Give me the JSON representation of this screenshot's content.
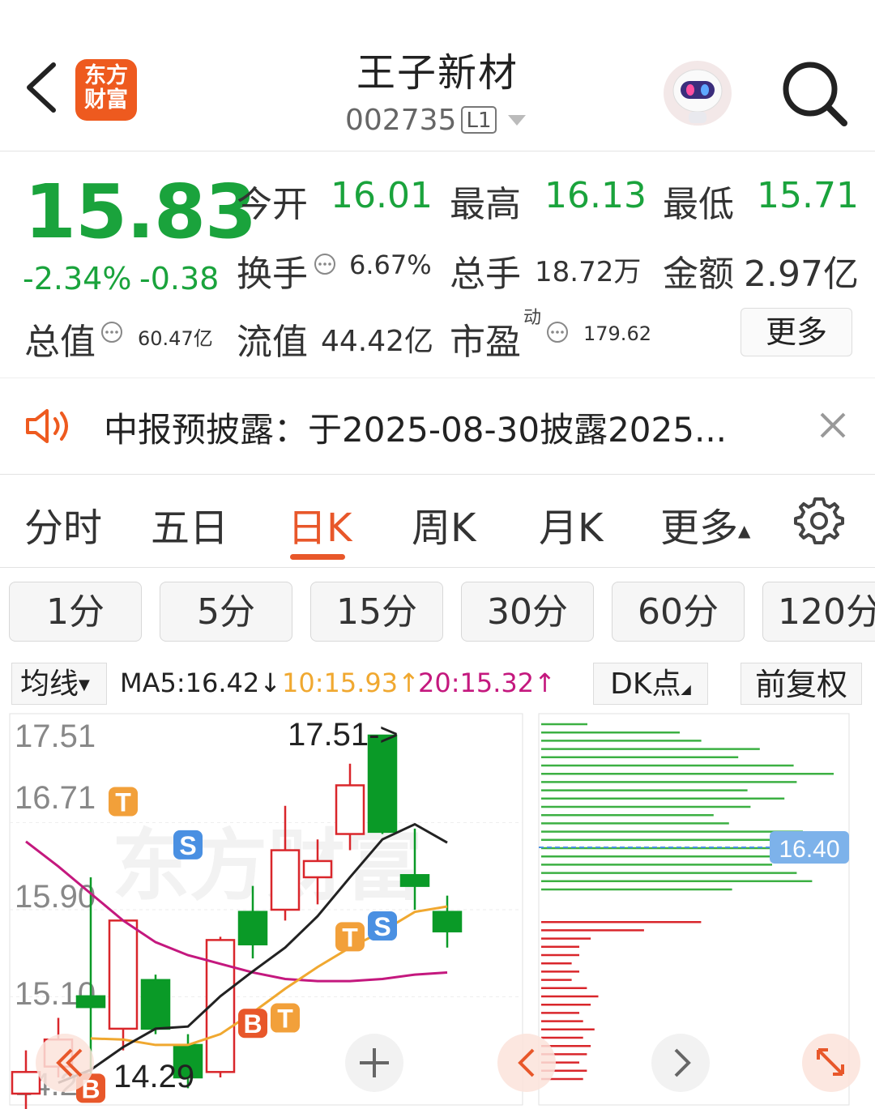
{
  "header": {
    "stock_name": "王子新材",
    "stock_code": "002735",
    "level_badge": "L1",
    "brand_logo_text": "东方财富"
  },
  "quote": {
    "price": "15.83",
    "change_pct": "-2.34%",
    "change_abs": "-0.38",
    "open_label": "今开",
    "open_value": "16.01",
    "high_label": "最高",
    "high_value": "16.13",
    "low_label": "最低",
    "low_value": "15.71",
    "turnover_label": "换手",
    "turnover_value": "6.67%",
    "volume_label": "总手",
    "volume_value": "18.72万",
    "amount_label": "金额",
    "amount_value": "2.97亿",
    "mktcap_label": "总值",
    "mktcap_value": "60.47亿",
    "float_label": "流值",
    "float_value": "44.42亿",
    "pe_label": "市盈",
    "pe_sup": "动",
    "pe_value": "179.62",
    "more_label": "更多"
  },
  "notice": {
    "text": "中报预披露：于2025-08-30披露2025..."
  },
  "tabs": {
    "items": [
      "分时",
      "五日",
      "日K",
      "周K",
      "月K",
      "更多"
    ],
    "active": "日K"
  },
  "minute_buttons": [
    "1分",
    "5分",
    "15分",
    "30分",
    "60分",
    "120分"
  ],
  "ma_row": {
    "ma_button": "均线",
    "ma5": "MA5:16.42",
    "ma10": "10:15.93",
    "ma20": "20:15.32",
    "dk_button": "DK点",
    "adjust_button": "前复权",
    "colors": {
      "ma5": "#222222",
      "ma10": "#f0a830",
      "ma20": "#c4187e"
    }
  },
  "chart": {
    "y_labels": [
      "17.51",
      "16.71",
      "15.90",
      "15.10",
      "14.29"
    ],
    "max_marker": "17.51->",
    "min_marker": "14.29",
    "price_tag": "16.40",
    "watermark": "东方财富",
    "colors": {
      "up": "#d9262b",
      "down": "#0a9a27"
    }
  },
  "chart_data": {
    "type": "candlestick",
    "ylim": [
      14.29,
      17.51
    ],
    "candles": [
      {
        "o": 14.2,
        "c": 14.4,
        "h": 14.6,
        "l": 14.0
      },
      {
        "o": 14.45,
        "c": 14.7,
        "h": 14.9,
        "l": 14.35
      },
      {
        "o": 15.1,
        "c": 15.0,
        "h": 16.2,
        "l": 14.3
      },
      {
        "o": 14.8,
        "c": 15.8,
        "h": 15.8,
        "l": 14.6
      },
      {
        "o": 15.25,
        "c": 14.8,
        "h": 15.3,
        "l": 14.75
      },
      {
        "o": 14.65,
        "c": 14.35,
        "h": 14.75,
        "l": 14.25
      },
      {
        "o": 14.4,
        "c": 15.62,
        "h": 15.65,
        "l": 14.35
      },
      {
        "o": 15.88,
        "c": 15.58,
        "h": 16.12,
        "l": 15.45
      },
      {
        "o": 15.9,
        "c": 16.45,
        "h": 16.86,
        "l": 15.8
      },
      {
        "o": 16.2,
        "c": 16.35,
        "h": 16.55,
        "l": 15.95
      },
      {
        "o": 16.6,
        "c": 17.05,
        "h": 17.25,
        "l": 16.45
      },
      {
        "o": 17.51,
        "c": 16.62,
        "h": 17.51,
        "l": 16.6
      },
      {
        "o": 16.22,
        "c": 16.12,
        "h": 16.65,
        "l": 15.9
      },
      {
        "o": 15.88,
        "c": 15.7,
        "h": 16.03,
        "l": 15.55
      }
    ],
    "ma5": [
      null,
      14.3,
      14.42,
      14.63,
      14.8,
      14.82,
      15.1,
      15.33,
      15.55,
      15.84,
      16.2,
      16.55,
      16.69,
      16.52
    ],
    "ma10": [
      null,
      null,
      14.71,
      14.7,
      14.65,
      14.65,
      14.75,
      14.95,
      15.17,
      15.37,
      15.55,
      15.7,
      15.88,
      15.93
    ],
    "ma20": [
      16.53,
      16.3,
      16.05,
      15.8,
      15.6,
      15.48,
      15.4,
      15.32,
      15.26,
      15.24,
      15.24,
      15.26,
      15.3,
      15.32
    ],
    "signals": [
      {
        "i": 2,
        "label": "B",
        "price": 14.25,
        "color": "#e8572a"
      },
      {
        "i": 3,
        "label": "T",
        "price": 16.9,
        "color": "#f2a03a"
      },
      {
        "i": 5,
        "label": "S",
        "price": 16.5,
        "color": "#4a90e2"
      },
      {
        "i": 7,
        "label": "B",
        "price": 14.85,
        "color": "#e8572a"
      },
      {
        "i": 8,
        "label": "T",
        "price": 14.9,
        "color": "#f2a03a"
      },
      {
        "i": 10,
        "label": "T",
        "price": 15.65,
        "color": "#f2a03a"
      },
      {
        "i": 11,
        "label": "S",
        "price": 15.75,
        "color": "#4a90e2"
      }
    ],
    "chip_distribution": {
      "profit": [
        0.15,
        0.45,
        0.52,
        0.71,
        0.64,
        0.82,
        0.95,
        0.83,
        0.67,
        0.79,
        0.68,
        0.56,
        0.61,
        0.85,
        0.93,
        0.88,
        0.81,
        0.75,
        0.83,
        0.88,
        0.62
      ],
      "loss": [
        0.42,
        0.27,
        0.13,
        0.1,
        0.1,
        0.08,
        0.1,
        0.08,
        0.12,
        0.15,
        0.13,
        0.1,
        0.11,
        0.14,
        0.11,
        0.13,
        0.12,
        0.1,
        0.12,
        0.11
      ]
    }
  }
}
